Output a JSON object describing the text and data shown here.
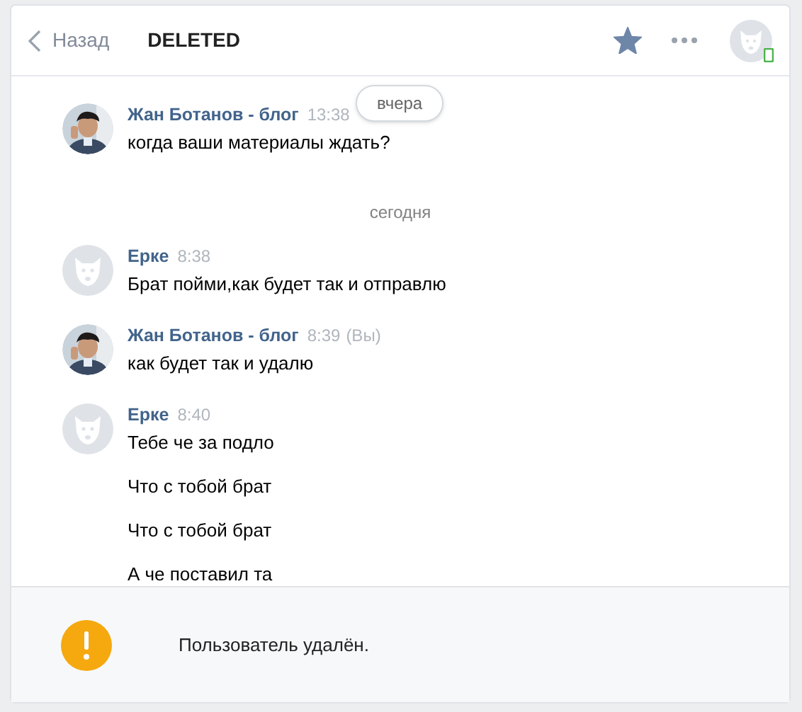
{
  "header": {
    "back_label": "Назад",
    "title": "DELETED",
    "starred": true,
    "online_mobile": true
  },
  "floating_date": "вчера",
  "items": [
    {
      "kind": "message",
      "author": "Жан Ботанов - блог",
      "time": "13:38",
      "lines": [
        "когда ваши материалы ждать?"
      ]
    },
    {
      "kind": "date",
      "label": "сегодня"
    },
    {
      "kind": "message",
      "avatar": {
        "kind": "placeholder"
      },
      "author": "Ерке",
      "time": "8:38",
      "lines": [
        "Брат пойми,как будет так и отправлю"
      ]
    },
    {
      "kind": "message",
      "author": "Жан Ботанов - блог",
      "time": "8:39",
      "suffix": "(Вы)",
      "lines": [
        "как будет так и удалю"
      ]
    },
    {
      "kind": "message",
      "avatar": {
        "kind": "placeholder"
      },
      "author": "Ерке",
      "time": "8:40",
      "lines": [
        "Тебе че за подло",
        "Что с тобой брат",
        "Что с тобой брат",
        "А че поставил та"
      ]
    }
  ],
  "notice": {
    "text": "Пользователь удалён."
  }
}
